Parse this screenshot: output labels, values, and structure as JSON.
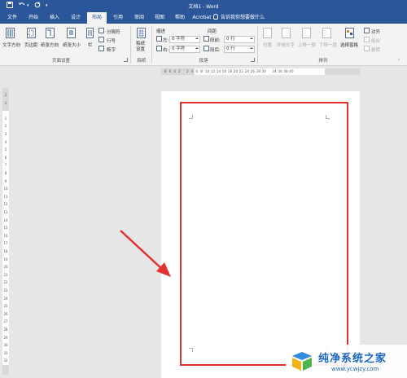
{
  "window": {
    "title": "文档1 - Word"
  },
  "quick_access": {
    "save_icon": "save-icon",
    "undo_icon": "undo-icon",
    "redo_icon": "redo-icon",
    "customize_icon": "customize-icon"
  },
  "tabs": [
    {
      "label": "文件"
    },
    {
      "label": "开始"
    },
    {
      "label": "插入"
    },
    {
      "label": "设计"
    },
    {
      "label": "布局"
    },
    {
      "label": "引用"
    },
    {
      "label": "审阅"
    },
    {
      "label": "视图"
    },
    {
      "label": "帮助"
    },
    {
      "label": "Acrobat"
    }
  ],
  "active_tab": "布局",
  "tell_me": "告诉我你想要做什么",
  "ribbon": {
    "page_setup": {
      "text_direction": "文字方向",
      "margins": "页边距",
      "orientation": "纸张方向",
      "size": "纸张大小",
      "columns": "栏",
      "breaks": "分隔符",
      "line_numbers": "行号",
      "hyphenation": "断字",
      "label": "页面设置"
    },
    "manuscript": {
      "settings": "稿纸\n设置",
      "label": "稿纸"
    },
    "paragraph": {
      "indent_header": "缩进",
      "spacing_header": "间距",
      "left_label": "左:",
      "left_value": "0 字符",
      "right_label": "右:",
      "right_value": "0 字符",
      "before_label": "段前:",
      "before_value": "0 行",
      "after_label": "段后:",
      "after_value": "0 行",
      "label": "段落"
    },
    "arrange": {
      "position": "位置",
      "wrap_text": "环绕文字",
      "bring_forward": "上移一层",
      "send_backward": "下移一层",
      "selection_pane": "选择窗格",
      "align": "对齐",
      "group": "组合",
      "rotate": "旋转",
      "label": "排列"
    }
  },
  "ruler": {
    "ticks": "8  6  4  2     2  4  6  8  10 12 14 16 18 20 22 24 26 28 30     34 36 38 40"
  },
  "vertical_ruler": {
    "numbers": [
      "2",
      "1",
      "",
      "1",
      "2",
      "3",
      "4",
      "5",
      "6",
      "7",
      "8",
      "9",
      "10",
      "11",
      "12",
      "13",
      "14",
      "15",
      "16",
      "17",
      "18",
      "19",
      "20",
      "21",
      "22",
      "23",
      "24",
      "25",
      "26",
      "27",
      "28",
      "29",
      "30",
      "31",
      "32"
    ]
  },
  "watermark": {
    "text": "纯净系统之家",
    "url": "www.ycwjzy.com"
  },
  "colors": {
    "word_blue": "#2b579a",
    "highlight_red": "#e23131"
  }
}
